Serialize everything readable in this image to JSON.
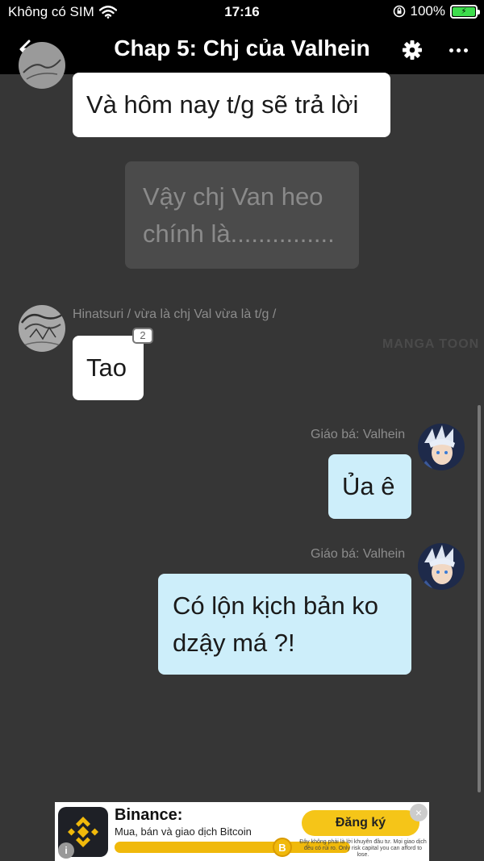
{
  "status_bar": {
    "carrier": "Không có SIM",
    "time": "17:16",
    "battery": "100%"
  },
  "nav": {
    "title": "Chap 5: Chj của Valhein",
    "back_icon": "arrow-left-icon",
    "settings_icon": "gear-icon",
    "more_icon": "more-horizontal-icon"
  },
  "messages": [
    {
      "type": "received",
      "text": "Và hôm nay t/g sẽ trả lời"
    },
    {
      "type": "narration",
      "lines": [
        "Vậy chj Van heo",
        "chính là..............."
      ]
    },
    {
      "type": "received",
      "sender": "Hinatsuri / vừa là chj Val vừa là t/g /",
      "text": "Tao",
      "badge": "2"
    },
    {
      "type": "sent",
      "sender": "Giáo bá: Valhein",
      "text": "Ủa ê"
    },
    {
      "type": "sent",
      "sender": "Giáo bá: Valhein",
      "lines": [
        "Có lộn kịch bản ko",
        "dzậy má ?!"
      ]
    }
  ],
  "watermark": "MANGA TOON",
  "ad": {
    "brand": "Binance:",
    "tagline": "Mua, bán và giao dịch Bitcoin",
    "cta": "Đăng ký",
    "coin_symbol": "B",
    "disclaimer": "Đây không phải là lời khuyên đầu tư. Mọi giao dịch đều có rủi ro. Only risk capital you can afford to lose.",
    "close": "×",
    "info": "i"
  },
  "colors": {
    "background": "#363636",
    "bar": "#000000",
    "sent_bubble": "#cdeefa",
    "received_bubble": "#ffffff",
    "narration_bubble": "#4b4b4b",
    "binance_yellow": "#f0b90b"
  }
}
